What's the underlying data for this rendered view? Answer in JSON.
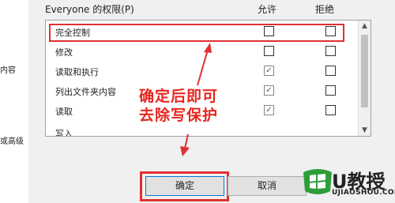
{
  "left_panel": {
    "texts": [
      "内容",
      "或高级"
    ]
  },
  "permissions": {
    "title": "Everyone 的权限(P)",
    "col_allow": "允许",
    "col_deny": "拒绝",
    "rows": [
      {
        "label": "完全控制",
        "allow": false,
        "deny": false
      },
      {
        "label": "修改",
        "allow": false,
        "deny": false
      },
      {
        "label": "读取和执行",
        "allow": true,
        "deny": false
      },
      {
        "label": "列出文件夹内容",
        "allow": true,
        "deny": false
      },
      {
        "label": "读取",
        "allow": true,
        "deny": false
      },
      {
        "label": "写入",
        "allow": false,
        "deny": false
      }
    ]
  },
  "annotation": {
    "line1": "确定后即可",
    "line2": "去除写保护",
    "color": "#e8261f"
  },
  "buttons": {
    "ok": "确定",
    "cancel": "取消"
  },
  "watermark": {
    "brand": "U教授",
    "site": "UJIAOSHOU.COM"
  }
}
